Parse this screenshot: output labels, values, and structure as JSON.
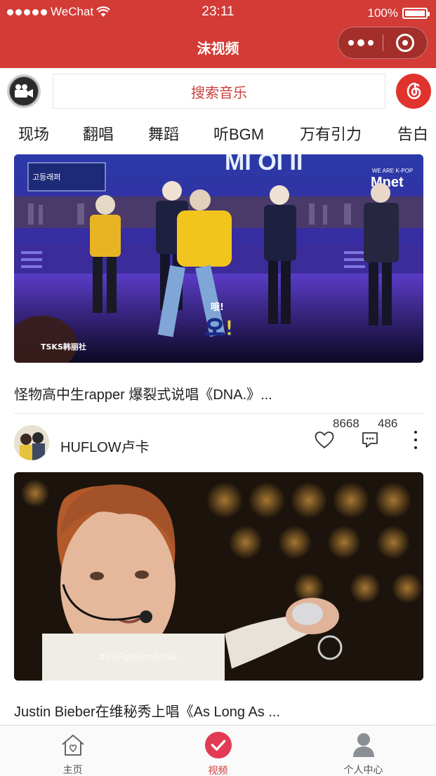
{
  "status_bar": {
    "carrier": "WeChat",
    "time": "23:11",
    "battery": "100%"
  },
  "nav": {
    "title": "沫视频"
  },
  "search": {
    "placeholder": "搜索音乐"
  },
  "tabs": [
    {
      "label": "现场",
      "active": true
    },
    {
      "label": "翻唱",
      "active": false
    },
    {
      "label": "舞蹈",
      "active": false
    },
    {
      "label": "听BGM",
      "active": false
    },
    {
      "label": "万有引力",
      "active": false
    },
    {
      "label": "告白",
      "active": false
    }
  ],
  "feed": [
    {
      "video_overlay": {
        "banner": "MI OI II",
        "logo": "Mnet",
        "logo_tag": "WE ARE K-POP",
        "corner": "고등래퍼",
        "subtitle_small": "哦!",
        "subtitle_big": "오!",
        "watermark": "TSKS韩丽社"
      },
      "caption": "怪物高中生rapper 爆裂式说唱《DNA.》..."
    },
    {
      "author": "HUFLOW卢卡",
      "likes": "8668",
      "comments": "486",
      "video_overlay": {
        "watermark": "#VSFashionShow"
      },
      "caption": "Justin Bieber在维秘秀上唱《As Long As ..."
    }
  ],
  "tabbar": [
    {
      "label": "主页",
      "icon": "home-icon",
      "active": false
    },
    {
      "label": "视频",
      "icon": "video-check-icon",
      "active": true
    },
    {
      "label": "个人中心",
      "icon": "user-icon",
      "active": false
    }
  ],
  "colors": {
    "brand": "#d23b36",
    "search_text": "#c8433c"
  }
}
